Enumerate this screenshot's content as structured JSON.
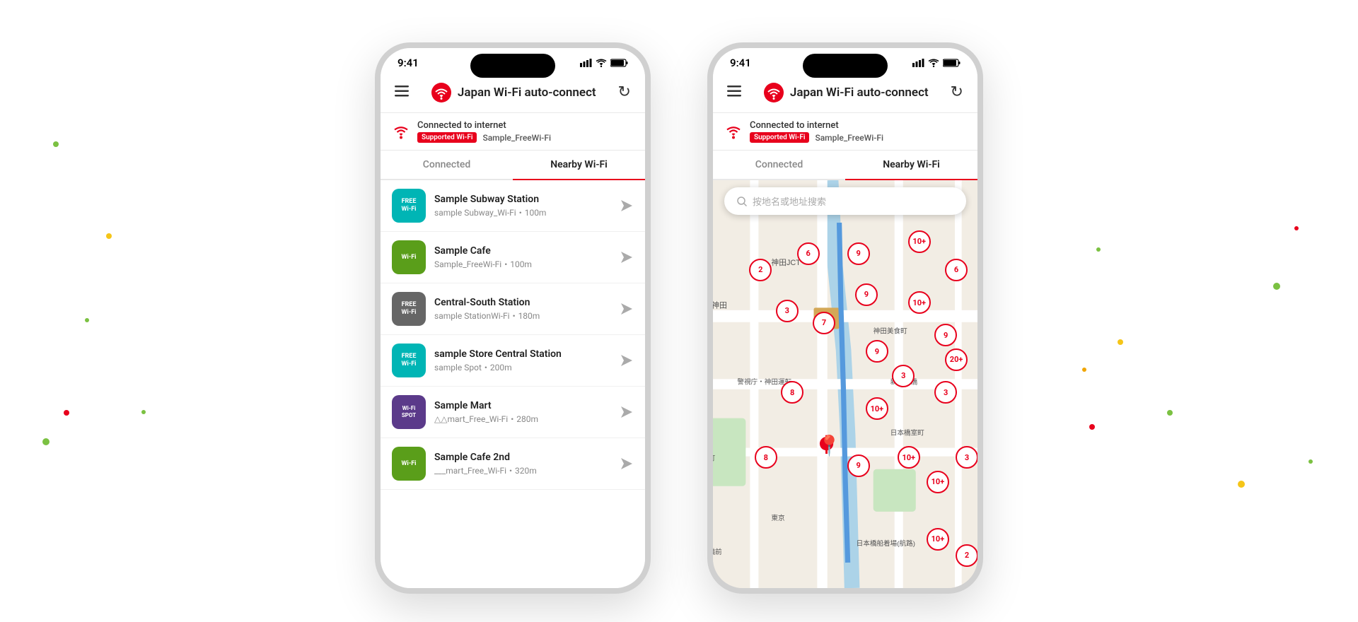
{
  "background": {
    "color": "#ffffff"
  },
  "phone1": {
    "status_bar": {
      "time": "9:41",
      "signal": "▋▋▋",
      "wifi": "WiFi",
      "battery": "🔋"
    },
    "header": {
      "menu_icon": "☰",
      "title": "Japan Wi-Fi auto-connect",
      "refresh_icon": "↻"
    },
    "connection_banner": {
      "text": "Connected to internet",
      "badge": "Supported Wi-Fi",
      "wifi_name": "Sample_FreeWi-Fi"
    },
    "tabs": [
      {
        "label": "Connected",
        "active": false
      },
      {
        "label": "Nearby Wi-Fi",
        "active": true
      }
    ],
    "wifi_items": [
      {
        "name": "Sample Subway Station",
        "detail": "sample Subway_Wi-Fi・100m",
        "icon_text": "FREE\nWi-Fi",
        "color": "teal"
      },
      {
        "name": "Sample Cafe",
        "detail": "Sample_FreeWi-Fi・100m",
        "icon_text": "Wi-Fi",
        "color": "green"
      },
      {
        "name": "Central-South Station",
        "detail": "sample StationWi-Fi・180m",
        "icon_text": "FREE\nWi-Fi",
        "color": "gray"
      },
      {
        "name": "sample Store Central Station",
        "detail": "sample Spot・200m",
        "icon_text": "FREE\nWi-Fi",
        "color": "teal2"
      },
      {
        "name": "Sample Mart",
        "detail": "△△mart_Free_Wi-Fi・280m",
        "icon_text": "Wi-Fi\nSPOT",
        "color": "purple"
      },
      {
        "name": "Sample Cafe 2nd",
        "detail": "___mart_Free_Wi-Fi・320m",
        "icon_text": "Wi-Fi",
        "color": "green2"
      }
    ]
  },
  "phone2": {
    "status_bar": {
      "time": "9:41",
      "signal": "▋▋▋",
      "wifi": "WiFi",
      "battery": "🔋"
    },
    "header": {
      "menu_icon": "☰",
      "title": "Japan Wi-Fi auto-connect",
      "refresh_icon": "↻"
    },
    "connection_banner": {
      "text": "Connected to internet",
      "badge": "Supported Wi-Fi",
      "wifi_name": "Sample_FreeWi-Fi"
    },
    "tabs": [
      {
        "label": "Connected",
        "active": false
      },
      {
        "label": "Nearby Wi-Fi",
        "active": true
      }
    ],
    "map": {
      "search_placeholder": "按地名或地址搜索",
      "clusters": [
        {
          "label": "2",
          "x": "18%",
          "y": "22%"
        },
        {
          "label": "6",
          "x": "36%",
          "y": "18%"
        },
        {
          "label": "9",
          "x": "55%",
          "y": "18%"
        },
        {
          "label": "10+",
          "x": "78%",
          "y": "15%"
        },
        {
          "label": "6",
          "x": "92%",
          "y": "22%"
        },
        {
          "label": "3",
          "x": "28%",
          "y": "32%"
        },
        {
          "label": "7",
          "x": "42%",
          "y": "35%"
        },
        {
          "label": "9",
          "x": "58%",
          "y": "28%"
        },
        {
          "label": "10+",
          "x": "78%",
          "y": "30%"
        },
        {
          "label": "9",
          "x": "88%",
          "y": "38%"
        },
        {
          "label": "9",
          "x": "62%",
          "y": "42%"
        },
        {
          "label": "20+",
          "x": "92%",
          "y": "44%"
        },
        {
          "label": "8",
          "x": "30%",
          "y": "52%"
        },
        {
          "label": "3",
          "x": "72%",
          "y": "48%"
        },
        {
          "label": "10+",
          "x": "62%",
          "y": "56%"
        },
        {
          "label": "3",
          "x": "88%",
          "y": "52%"
        },
        {
          "label": "8",
          "x": "20%",
          "y": "68%"
        },
        {
          "label": "9",
          "x": "55%",
          "y": "70%"
        },
        {
          "label": "10+",
          "x": "74%",
          "y": "68%"
        },
        {
          "label": "10+",
          "x": "85%",
          "y": "74%"
        },
        {
          "label": "3",
          "x": "96%",
          "y": "68%"
        },
        {
          "label": "10+",
          "x": "85%",
          "y": "88%"
        },
        {
          "label": "2",
          "x": "96%",
          "y": "92%"
        }
      ]
    }
  }
}
